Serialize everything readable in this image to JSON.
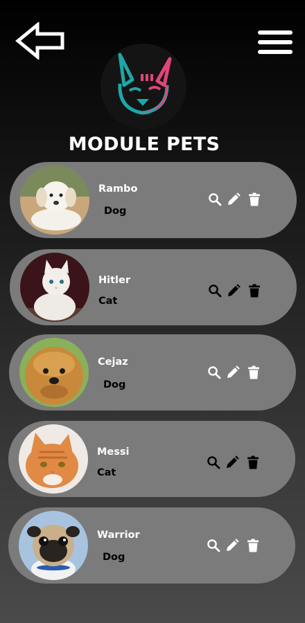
{
  "header": {
    "title": "MODULE PETS",
    "back_icon": "arrow-left-outline-icon",
    "menu_icon": "hamburger-menu-icon",
    "logo": "french-bulldog-logo"
  },
  "colors": {
    "card": "#7b7b7b",
    "logo_teal": "#1fa6a6",
    "logo_pink": "#e0457b"
  },
  "pets": [
    {
      "name": "Rambo",
      "type": "Dog",
      "photo": "white-puppy-photo"
    },
    {
      "name": "Hitler",
      "type": "Cat",
      "photo": "white-kitten-photo"
    },
    {
      "name": "Cejaz",
      "type": "Dog",
      "photo": "yorkshire-terrier-photo"
    },
    {
      "name": "Messi",
      "type": "Cat",
      "photo": "orange-tabby-cat-photo"
    },
    {
      "name": "Warrior",
      "type": "Dog",
      "photo": "pug-photo"
    }
  ]
}
